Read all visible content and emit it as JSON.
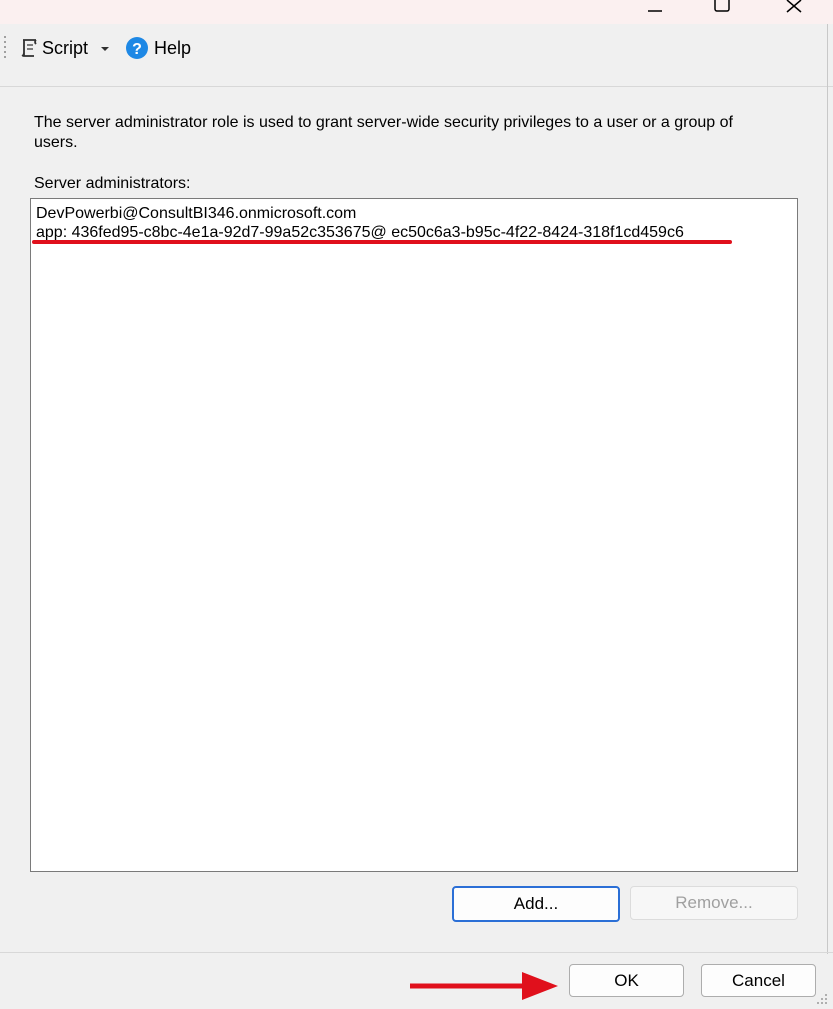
{
  "toolbar": {
    "script_label": "Script",
    "help_label": "Help"
  },
  "description": "The server administrator role is used to grant server-wide security privileges to a user or a group of users.",
  "admins": {
    "label": "Server administrators:",
    "items": [
      "DevPowerbi@ConsultBI346.onmicrosoft.com",
      "app: 436fed95-c8bc-4e1a-92d7-99a52c353675@ ec50c6a3-b95c-4f22-8424-318f1cd459c6"
    ]
  },
  "buttons": {
    "add": "Add...",
    "remove": "Remove...",
    "ok": "OK",
    "cancel": "Cancel"
  },
  "annotation": {
    "color": "#e0101c"
  }
}
